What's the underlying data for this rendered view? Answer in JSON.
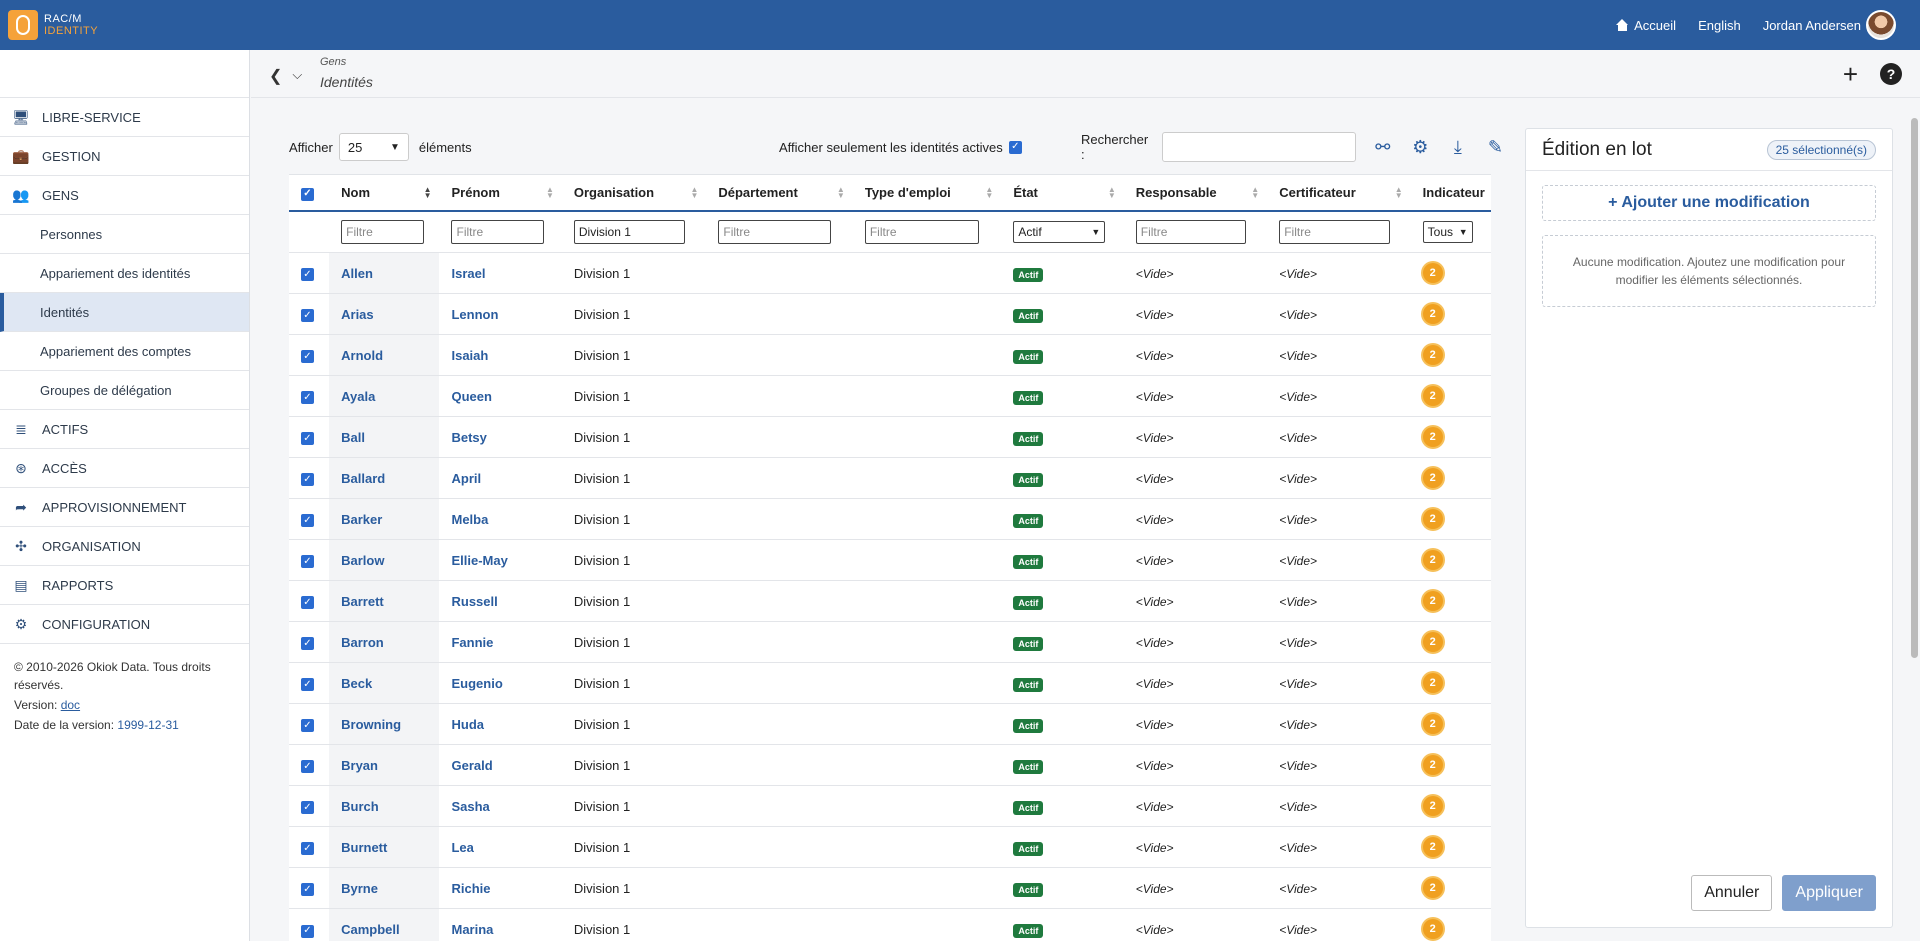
{
  "app": {
    "logo_line1": "RAC/M",
    "logo_line2": "IDENTITY",
    "home": "Accueil",
    "language": "English",
    "user": "Jordan Andersen"
  },
  "sidebar": {
    "items": [
      {
        "label": "LIBRE-SERVICE",
        "icon": "monitor-icon",
        "glyph": "🖥"
      },
      {
        "label": "GESTION",
        "icon": "briefcase-icon",
        "glyph": "💼"
      },
      {
        "label": "GENS",
        "icon": "users-icon",
        "glyph": "👥"
      }
    ],
    "subitems": [
      "Personnes",
      "Appariement des identités",
      "Identités",
      "Appariement des comptes",
      "Groupes de délégation"
    ],
    "items2": [
      {
        "label": "ACTIFS",
        "icon": "database-icon",
        "glyph": "≣"
      },
      {
        "label": "ACCÈS",
        "icon": "fingerprint-icon",
        "glyph": "⊛"
      },
      {
        "label": "APPROVISIONNEMENT",
        "icon": "share-icon",
        "glyph": "➦"
      },
      {
        "label": "ORGANISATION",
        "icon": "network-icon",
        "glyph": "✣"
      },
      {
        "label": "RAPPORTS",
        "icon": "file-icon",
        "glyph": "▤"
      },
      {
        "label": "CONFIGURATION",
        "icon": "cogs-icon",
        "glyph": "⚙"
      }
    ],
    "footer": {
      "copyright": "© 2010-2026 Okiok Data. Tous droits réservés.",
      "version_label": "Version:",
      "version_link": "doc",
      "date_label": "Date de la version:",
      "date_value": "1999-12-31"
    }
  },
  "breadcrumb": {
    "parent": "Gens",
    "title": "Identités"
  },
  "toolbar": {
    "show_label": "Afficher",
    "page_size": "25",
    "elements_label": "éléments",
    "active_only_label": "Afficher seulement les identités actives",
    "search_label": "Rechercher :"
  },
  "table": {
    "headers": [
      "Nom",
      "Prénom",
      "Organisation",
      "Département",
      "Type d'emploi",
      "État",
      "Responsable",
      "Certificateur",
      "Indicateur"
    ],
    "filter_placeholder": "Filtre",
    "filter_org": "Division 1",
    "filter_state": "Actif",
    "filter_indicator": "Tous",
    "rows": [
      {
        "nom": "Allen",
        "prenom": "Israel",
        "org": "Division 1",
        "etat": "Actif",
        "resp": "<Vide>",
        "cert": "<Vide>",
        "ind": "2"
      },
      {
        "nom": "Arias",
        "prenom": "Lennon",
        "org": "Division 1",
        "etat": "Actif",
        "resp": "<Vide>",
        "cert": "<Vide>",
        "ind": "2"
      },
      {
        "nom": "Arnold",
        "prenom": "Isaiah",
        "org": "Division 1",
        "etat": "Actif",
        "resp": "<Vide>",
        "cert": "<Vide>",
        "ind": "2"
      },
      {
        "nom": "Ayala",
        "prenom": "Queen",
        "org": "Division 1",
        "etat": "Actif",
        "resp": "<Vide>",
        "cert": "<Vide>",
        "ind": "2"
      },
      {
        "nom": "Ball",
        "prenom": "Betsy",
        "org": "Division 1",
        "etat": "Actif",
        "resp": "<Vide>",
        "cert": "<Vide>",
        "ind": "2"
      },
      {
        "nom": "Ballard",
        "prenom": "April",
        "org": "Division 1",
        "etat": "Actif",
        "resp": "<Vide>",
        "cert": "<Vide>",
        "ind": "2"
      },
      {
        "nom": "Barker",
        "prenom": "Melba",
        "org": "Division 1",
        "etat": "Actif",
        "resp": "<Vide>",
        "cert": "<Vide>",
        "ind": "2"
      },
      {
        "nom": "Barlow",
        "prenom": "Ellie-May",
        "org": "Division 1",
        "etat": "Actif",
        "resp": "<Vide>",
        "cert": "<Vide>",
        "ind": "2"
      },
      {
        "nom": "Barrett",
        "prenom": "Russell",
        "org": "Division 1",
        "etat": "Actif",
        "resp": "<Vide>",
        "cert": "<Vide>",
        "ind": "2"
      },
      {
        "nom": "Barron",
        "prenom": "Fannie",
        "org": "Division 1",
        "etat": "Actif",
        "resp": "<Vide>",
        "cert": "<Vide>",
        "ind": "2"
      },
      {
        "nom": "Beck",
        "prenom": "Eugenio",
        "org": "Division 1",
        "etat": "Actif",
        "resp": "<Vide>",
        "cert": "<Vide>",
        "ind": "2"
      },
      {
        "nom": "Browning",
        "prenom": "Huda",
        "org": "Division 1",
        "etat": "Actif",
        "resp": "<Vide>",
        "cert": "<Vide>",
        "ind": "2"
      },
      {
        "nom": "Bryan",
        "prenom": "Gerald",
        "org": "Division 1",
        "etat": "Actif",
        "resp": "<Vide>",
        "cert": "<Vide>",
        "ind": "2"
      },
      {
        "nom": "Burch",
        "prenom": "Sasha",
        "org": "Division 1",
        "etat": "Actif",
        "resp": "<Vide>",
        "cert": "<Vide>",
        "ind": "2"
      },
      {
        "nom": "Burnett",
        "prenom": "Lea",
        "org": "Division 1",
        "etat": "Actif",
        "resp": "<Vide>",
        "cert": "<Vide>",
        "ind": "2"
      },
      {
        "nom": "Byrne",
        "prenom": "Richie",
        "org": "Division 1",
        "etat": "Actif",
        "resp": "<Vide>",
        "cert": "<Vide>",
        "ind": "2"
      },
      {
        "nom": "Campbell",
        "prenom": "Marina",
        "org": "Division 1",
        "etat": "Actif",
        "resp": "<Vide>",
        "cert": "<Vide>",
        "ind": "2"
      }
    ]
  },
  "panel": {
    "title": "Édition en lot",
    "selected": "25 sélectionné(s)",
    "add_label": "+ Ajouter une modification",
    "empty_text": "Aucune modification. Ajoutez une modification pour modifier les éléments sélectionnés.",
    "cancel": "Annuler",
    "apply": "Appliquer"
  },
  "colors": {
    "primary": "#2a5c9e",
    "accent": "#f5a23a",
    "active_badge": "#1f7a3e",
    "indicator": "#f0a020"
  }
}
